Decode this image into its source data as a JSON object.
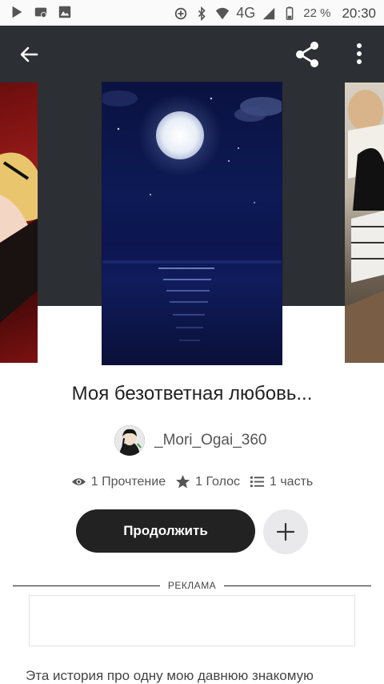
{
  "status_bar": {
    "network": "4G",
    "battery": "22 %",
    "time": "20:30",
    "icons": [
      "play-store-icon",
      "media-icon",
      "image-icon",
      "data-saver-icon",
      "bluetooth-icon",
      "wifi-icon",
      "signal-icon",
      "battery-icon"
    ]
  },
  "header": {
    "back_icon": "arrow-left-icon",
    "share_icon": "share-icon",
    "more_icon": "more-vertical-icon"
  },
  "story": {
    "title": "Моя безответная любовь...",
    "author": "_Mori_Ogai_360",
    "reads": "1 Прочтение",
    "votes": "1 Голос",
    "parts": "1 часть"
  },
  "actions": {
    "continue_label": "Продолжить",
    "add_icon": "plus-icon"
  },
  "ad": {
    "label": "РЕКЛАМА"
  },
  "description": "Эта история про одну мою давнюю знакомую",
  "colors": {
    "hero_bg": "#2c2f33",
    "button_dark": "#222222",
    "add_bg": "#e9e9ec"
  }
}
